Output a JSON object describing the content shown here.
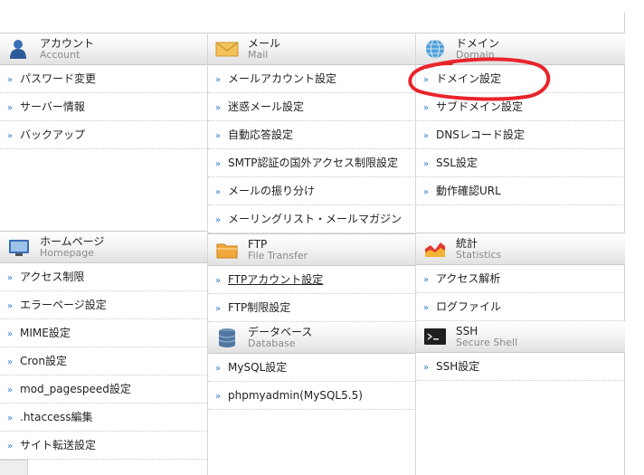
{
  "sections": {
    "account": {
      "title": "アカウント",
      "sub": "Account",
      "items": [
        "パスワード変更",
        "サーバー情報",
        "バックアップ"
      ]
    },
    "mail": {
      "title": "メール",
      "sub": "Mail",
      "items": [
        "メールアカウント設定",
        "迷惑メール設定",
        "自動応答設定",
        "SMTP認証の国外アクセス制限設定",
        "メールの振り分け",
        "メーリングリスト・メールマガジン"
      ]
    },
    "domain": {
      "title": "ドメイン",
      "sub": "Domain",
      "items": [
        "ドメイン設定",
        "サブドメイン設定",
        "DNSレコード設定",
        "SSL設定",
        "動作確認URL"
      ]
    },
    "homepage": {
      "title": "ホームページ",
      "sub": "Homepage",
      "items": [
        "アクセス制限",
        "エラーページ設定",
        "MIME設定",
        "Cron設定",
        "mod_pagespeed設定",
        ".htaccess編集",
        "サイト転送設定"
      ]
    },
    "ftp": {
      "title": "FTP",
      "sub": "File Transfer",
      "items": [
        "FTPアカウント設定",
        "FTP制限設定"
      ]
    },
    "statistics": {
      "title": "統計",
      "sub": "Statistics",
      "items": [
        "アクセス解析",
        "ログファイル"
      ]
    },
    "database": {
      "title": "データベース",
      "sub": "Database",
      "items": [
        "MySQL設定",
        "phpmyadmin(MySQL5.5)"
      ]
    },
    "ssh": {
      "title": "SSH",
      "sub": "Secure Shell",
      "items": [
        "SSH設定"
      ]
    }
  },
  "colors": {
    "arrow": "#2e7fc6",
    "annotation": "#e8242a"
  }
}
